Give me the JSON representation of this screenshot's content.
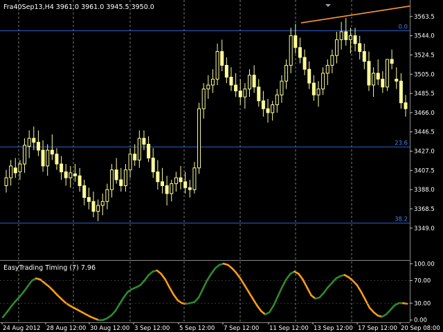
{
  "window": {
    "header": "Fra40Sep13,H4  3961.0 3961.0 3945.5 3950.0"
  },
  "indicator": {
    "title": "EasyTrading Timing (7) 7.96"
  },
  "colors": {
    "background": "#000000",
    "grid": "#c8c8c8",
    "candle_up": "#ffff99",
    "candle_down": "#ffff99",
    "fib_line": "#2f5fd0",
    "fib_label": "#4f7fd8",
    "trendline": "#ff9933",
    "ind_up": "#2e8b2e",
    "ind_down": "#ff9d1a",
    "separator": "#8a8a8a"
  },
  "fib_levels": [
    {
      "price": 3549.6,
      "label": "0.0"
    },
    {
      "price": 3431.4,
      "label": "23.6"
    },
    {
      "price": 3354.6,
      "label": "38.2"
    }
  ],
  "price_axis": {
    "range": [
      3318,
      3576
    ],
    "ticks": [
      "3563.5",
      "3544.0",
      "3524.5",
      "3505.0",
      "3485.5",
      "3466.0",
      "3446.5",
      "3427.0",
      "3407.5",
      "3388.0",
      "3368.5",
      "3349.0"
    ]
  },
  "indicator_axis": {
    "range": [
      -4,
      104
    ],
    "ticks": [
      "100.00",
      "70.00",
      "30.00",
      "0.00"
    ]
  },
  "time_axis": {
    "labels": [
      "24 Aug 2012",
      "28 Aug 12:00",
      "30 Aug 12:00",
      "3 Sep 12:00",
      "5 Sep 12:00",
      "7 Sep 12:00",
      "11 Sep 12:00",
      "13 Sep 12:00",
      "17 Sep 12:00",
      "20 Sep 08:00"
    ]
  },
  "chart_data": {
    "type": "candlestick",
    "symbol": "Fra40Sep13",
    "timeframe": "H4",
    "ylim": [
      3318,
      3576
    ],
    "candles": [
      [
        3392,
        3408,
        3385,
        3400
      ],
      [
        3400,
        3418,
        3392,
        3412
      ],
      [
        3410,
        3420,
        3400,
        3405
      ],
      [
        3406,
        3418,
        3398,
        3414
      ],
      [
        3414,
        3440,
        3405,
        3433
      ],
      [
        3432,
        3448,
        3420,
        3440
      ],
      [
        3440,
        3452,
        3428,
        3436
      ],
      [
        3436,
        3448,
        3422,
        3428
      ],
      [
        3428,
        3438,
        3406,
        3412
      ],
      [
        3412,
        3434,
        3402,
        3428
      ],
      [
        3428,
        3444,
        3418,
        3424
      ],
      [
        3424,
        3430,
        3408,
        3414
      ],
      [
        3414,
        3422,
        3398,
        3406
      ],
      [
        3406,
        3414,
        3392,
        3400
      ],
      [
        3400,
        3412,
        3390,
        3405
      ],
      [
        3404,
        3414,
        3396,
        3402
      ],
      [
        3402,
        3410,
        3386,
        3392
      ],
      [
        3392,
        3398,
        3372,
        3380
      ],
      [
        3380,
        3390,
        3368,
        3376
      ],
      [
        3376,
        3386,
        3360,
        3366
      ],
      [
        3366,
        3378,
        3356,
        3372
      ],
      [
        3372,
        3384,
        3362,
        3376
      ],
      [
        3376,
        3394,
        3368,
        3388
      ],
      [
        3388,
        3414,
        3380,
        3408
      ],
      [
        3408,
        3420,
        3394,
        3398
      ],
      [
        3398,
        3410,
        3386,
        3392
      ],
      [
        3392,
        3414,
        3386,
        3408
      ],
      [
        3408,
        3430,
        3400,
        3424
      ],
      [
        3424,
        3434,
        3412,
        3418
      ],
      [
        3418,
        3448,
        3410,
        3440
      ],
      [
        3440,
        3448,
        3428,
        3434
      ],
      [
        3434,
        3442,
        3416,
        3420
      ],
      [
        3420,
        3430,
        3400,
        3406
      ],
      [
        3406,
        3418,
        3388,
        3396
      ],
      [
        3396,
        3410,
        3384,
        3392
      ],
      [
        3392,
        3402,
        3372,
        3384
      ],
      [
        3384,
        3398,
        3376,
        3394
      ],
      [
        3394,
        3406,
        3386,
        3400
      ],
      [
        3400,
        3412,
        3388,
        3396
      ],
      [
        3396,
        3406,
        3384,
        3390
      ],
      [
        3390,
        3398,
        3380,
        3388
      ],
      [
        3388,
        3416,
        3384,
        3410
      ],
      [
        3410,
        3476,
        3404,
        3470
      ],
      [
        3470,
        3496,
        3460,
        3490
      ],
      [
        3490,
        3504,
        3480,
        3494
      ],
      [
        3494,
        3510,
        3486,
        3500
      ],
      [
        3500,
        3536,
        3494,
        3528
      ],
      [
        3528,
        3540,
        3508,
        3514
      ],
      [
        3514,
        3522,
        3496,
        3502
      ],
      [
        3502,
        3512,
        3488,
        3494
      ],
      [
        3494,
        3506,
        3482,
        3488
      ],
      [
        3488,
        3500,
        3474,
        3482
      ],
      [
        3482,
        3496,
        3470,
        3490
      ],
      [
        3490,
        3510,
        3482,
        3504
      ],
      [
        3504,
        3514,
        3486,
        3492
      ],
      [
        3492,
        3500,
        3472,
        3478
      ],
      [
        3478,
        3488,
        3462,
        3470
      ],
      [
        3470,
        3480,
        3456,
        3466
      ],
      [
        3466,
        3478,
        3458,
        3474
      ],
      [
        3474,
        3490,
        3466,
        3484
      ],
      [
        3484,
        3504,
        3476,
        3498
      ],
      [
        3498,
        3520,
        3490,
        3514
      ],
      [
        3514,
        3552,
        3506,
        3544
      ],
      [
        3544,
        3556,
        3526,
        3532
      ],
      [
        3532,
        3542,
        3516,
        3522
      ],
      [
        3522,
        3530,
        3504,
        3510
      ],
      [
        3510,
        3518,
        3490,
        3496
      ],
      [
        3496,
        3504,
        3478,
        3484
      ],
      [
        3484,
        3498,
        3472,
        3490
      ],
      [
        3490,
        3512,
        3484,
        3506
      ],
      [
        3506,
        3520,
        3494,
        3514
      ],
      [
        3514,
        3530,
        3506,
        3524
      ],
      [
        3524,
        3548,
        3516,
        3540
      ],
      [
        3540,
        3558,
        3530,
        3548
      ],
      [
        3548,
        3562,
        3534,
        3540
      ],
      [
        3540,
        3552,
        3526,
        3544
      ],
      [
        3544,
        3552,
        3528,
        3536
      ],
      [
        3536,
        3544,
        3520,
        3528
      ],
      [
        3528,
        3536,
        3510,
        3518
      ],
      [
        3518,
        3528,
        3488,
        3494
      ],
      [
        3494,
        3512,
        3482,
        3506
      ],
      [
        3506,
        3520,
        3494,
        3500
      ],
      [
        3500,
        3508,
        3486,
        3492
      ],
      [
        3492,
        3516,
        3488,
        3520
      ],
      [
        3520,
        3530,
        3510,
        3516
      ],
      [
        3500,
        3512,
        3490,
        3498
      ],
      [
        3498,
        3506,
        3470,
        3476
      ],
      [
        3476,
        3484,
        3462,
        3470
      ]
    ],
    "indicator": {
      "name": "EasyTrading Timing",
      "period": 7,
      "last_value": 7.96,
      "values": [
        5,
        14,
        24,
        33,
        41,
        50,
        60,
        70,
        74,
        72,
        66,
        60,
        53,
        45,
        38,
        31,
        26,
        22,
        18,
        14,
        10,
        6,
        3,
        0,
        0,
        3,
        8,
        16,
        28,
        40,
        50,
        55,
        58,
        62,
        70,
        80,
        86,
        88,
        82,
        72,
        58,
        45,
        35,
        30,
        29,
        30,
        32,
        40,
        55,
        70,
        82,
        92,
        98,
        100,
        98,
        92,
        84,
        74,
        62,
        50,
        38,
        26,
        16,
        10,
        14,
        26,
        42,
        58,
        72,
        82,
        86,
        82,
        72,
        58,
        44,
        38,
        40,
        48,
        58,
        66,
        74,
        78,
        80,
        76,
        70,
        62,
        50,
        36,
        22,
        14,
        8,
        6,
        10,
        18,
        26,
        30,
        30,
        29
      ]
    },
    "trendline": {
      "from": [
        3557,
        "13 Sep"
      ],
      "to": [
        3574,
        "20 Sep"
      ]
    }
  }
}
